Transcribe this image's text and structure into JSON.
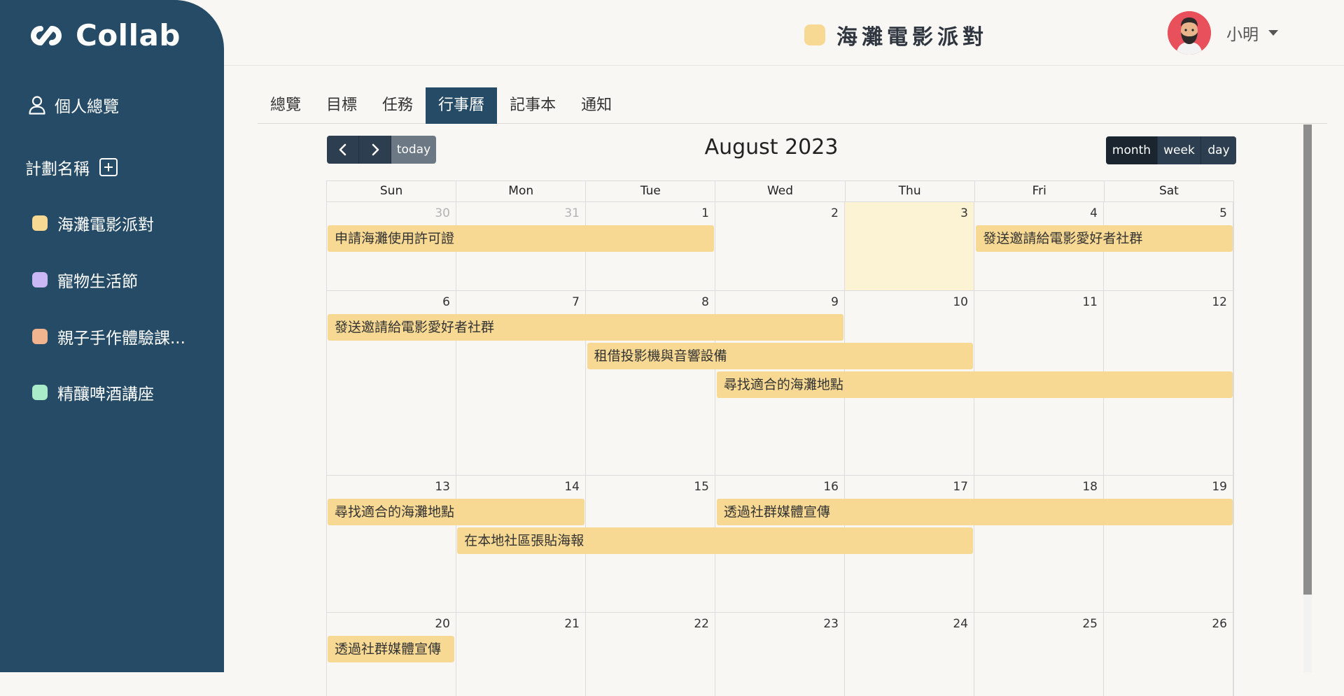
{
  "app": {
    "logo_text": "Collab"
  },
  "sidebar": {
    "overview_label": "個人總覽",
    "section_label": "計劃名稱",
    "projects": [
      {
        "label": "海灘電影派對",
        "color": "#f7d993"
      },
      {
        "label": "寵物生活節",
        "color": "#c9b8f5"
      },
      {
        "label": "親子手作體驗課...",
        "color": "#f2b38f"
      },
      {
        "label": "精釀啤酒講座",
        "color": "#a8ecc9"
      }
    ]
  },
  "header": {
    "project_title": "海灘電影派對",
    "project_color": "#f7d993",
    "username": "小明"
  },
  "tabs": [
    {
      "label": "總覽",
      "active": false
    },
    {
      "label": "目標",
      "active": false
    },
    {
      "label": "任務",
      "active": false
    },
    {
      "label": "行事曆",
      "active": true
    },
    {
      "label": "記事本",
      "active": false
    },
    {
      "label": "通知",
      "active": false
    }
  ],
  "calendar": {
    "title": "August 2023",
    "prev_label": "‹",
    "next_label": "›",
    "today_label": "today",
    "views": [
      {
        "label": "month",
        "active": true
      },
      {
        "label": "week",
        "active": false
      },
      {
        "label": "day",
        "active": false
      }
    ],
    "days_of_week": [
      "Sun",
      "Mon",
      "Tue",
      "Wed",
      "Thu",
      "Fri",
      "Sat"
    ],
    "event_color": "#f7d993",
    "weeks": [
      {
        "days": [
          {
            "num": "30",
            "muted": true
          },
          {
            "num": "31",
            "muted": true
          },
          {
            "num": "1"
          },
          {
            "num": "2"
          },
          {
            "num": "3",
            "today": true
          },
          {
            "num": "4"
          },
          {
            "num": "5"
          }
        ],
        "events": [
          {
            "title": "申請海灘使用許可證",
            "start": 0,
            "span": 3,
            "row": 0
          },
          {
            "title": "發送邀請給電影愛好者社群",
            "start": 5,
            "span": 2,
            "row": 0
          }
        ]
      },
      {
        "days": [
          {
            "num": "6"
          },
          {
            "num": "7"
          },
          {
            "num": "8"
          },
          {
            "num": "9"
          },
          {
            "num": "10"
          },
          {
            "num": "11"
          },
          {
            "num": "12"
          }
        ],
        "events": [
          {
            "title": "發送邀請給電影愛好者社群",
            "start": 0,
            "span": 4,
            "row": 0
          },
          {
            "title": "租借投影機與音響設備",
            "start": 2,
            "span": 3,
            "row": 1
          },
          {
            "title": "尋找適合的海灘地點",
            "start": 3,
            "span": 4,
            "row": 2
          }
        ]
      },
      {
        "days": [
          {
            "num": "13"
          },
          {
            "num": "14"
          },
          {
            "num": "15"
          },
          {
            "num": "16"
          },
          {
            "num": "17"
          },
          {
            "num": "18"
          },
          {
            "num": "19"
          }
        ],
        "events": [
          {
            "title": "尋找適合的海灘地點",
            "start": 0,
            "span": 2,
            "row": 0
          },
          {
            "title": "透過社群媒體宣傳",
            "start": 3,
            "span": 4,
            "row": 0
          },
          {
            "title": "在本地社區張貼海報",
            "start": 1,
            "span": 4,
            "row": 1
          }
        ]
      },
      {
        "days": [
          {
            "num": "20"
          },
          {
            "num": "21"
          },
          {
            "num": "22"
          },
          {
            "num": "23"
          },
          {
            "num": "24"
          },
          {
            "num": "25"
          },
          {
            "num": "26"
          }
        ],
        "events": [
          {
            "title": "透過社群媒體宣傳",
            "start": 0,
            "span": 1,
            "row": 0
          }
        ]
      }
    ]
  }
}
